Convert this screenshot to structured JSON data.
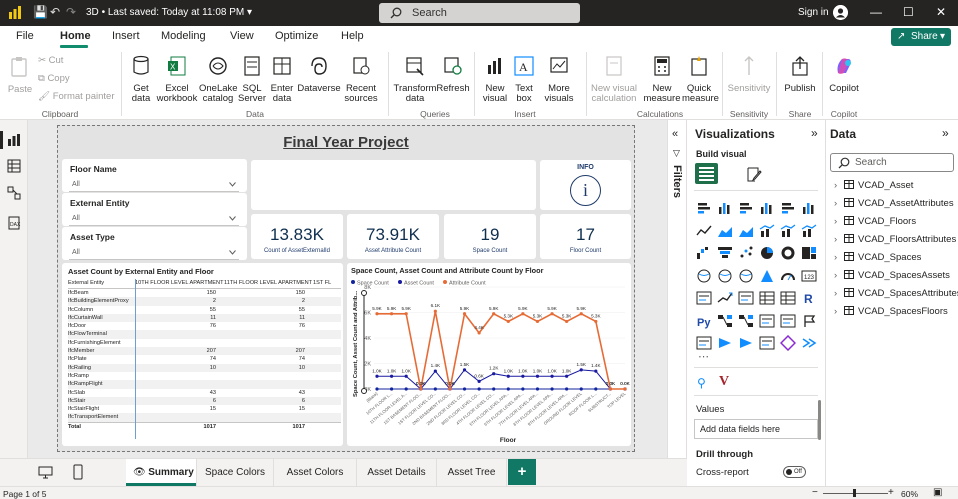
{
  "titlebar": {
    "doc_title": "3D",
    "saved_status": "Last saved: Today at 11:08 PM",
    "search_placeholder": "Search",
    "sign_in": "Sign in"
  },
  "menu": {
    "items": [
      "File",
      "Home",
      "Insert",
      "Modeling",
      "View",
      "Optimize",
      "Help"
    ],
    "active": "Home",
    "share_label": "Share"
  },
  "ribbon": {
    "clipboard": {
      "paste": "Paste",
      "cut": "Cut",
      "copy": "Copy",
      "format_painter": "Format painter",
      "group": "Clipboard"
    },
    "data": {
      "get_data": "Get data",
      "excel": "Excel workbook",
      "onelake": "OneLake catalog",
      "sql": "SQL Server",
      "enter": "Enter data",
      "dataverse": "Dataverse",
      "recent": "Recent sources",
      "group": "Data"
    },
    "queries": {
      "transform": "Transform data",
      "refresh": "Refresh",
      "group": "Queries"
    },
    "insert": {
      "new_visual": "New visual",
      "text_box": "Text box",
      "more_visuals": "More visuals",
      "group": "Insert"
    },
    "calculations": {
      "new_visual_calc": "New visual calculation",
      "new_measure": "New measure",
      "quick_measure": "Quick measure",
      "group": "Calculations"
    },
    "sensitivity": {
      "label": "Sensitivity",
      "group": "Sensitivity"
    },
    "share": {
      "publish": "Publish",
      "group": "Share"
    },
    "copilot": {
      "label": "Copilot",
      "group": "Copilot"
    }
  },
  "report": {
    "title": "Final Year Project",
    "slicers": [
      {
        "label": "Floor Name",
        "value": "All"
      },
      {
        "label": "External Entity",
        "value": "All"
      },
      {
        "label": "Asset Type",
        "value": "All"
      }
    ],
    "info_label": "INFO",
    "info_icon": "i",
    "kpis": [
      {
        "value": "13.83K",
        "label": "Count of AssetExternalId"
      },
      {
        "value": "73.91K",
        "label": "Asset Attribute Count"
      },
      {
        "value": "19",
        "label": "Space Count"
      },
      {
        "value": "17",
        "label": "Floor Count"
      }
    ],
    "table": {
      "title": "Asset Count by External Entity and Floor",
      "headers": [
        "External Entity",
        "10TH FLOOR LEVEL APARTMENT",
        "11TH FLOOR LEVEL APARTMENT",
        "1ST FL"
      ],
      "rows": [
        [
          "IfcBeam",
          "150",
          "150"
        ],
        [
          "IfcBuildingElementProxy",
          "2",
          "2"
        ],
        [
          "IfcColumn",
          "55",
          "55"
        ],
        [
          "IfcCurtainWall",
          "11",
          "11"
        ],
        [
          "IfcDoor",
          "76",
          "76"
        ],
        [
          "IfcFlowTerminal",
          "",
          ""
        ],
        [
          "IfcFurnishingElement",
          "",
          ""
        ],
        [
          "IfcMember",
          "207",
          "207"
        ],
        [
          "IfcPlate",
          "74",
          "74"
        ],
        [
          "IfcRailing",
          "10",
          "10"
        ],
        [
          "IfcRamp",
          "",
          ""
        ],
        [
          "IfcRampFlight",
          "",
          ""
        ],
        [
          "IfcSlab",
          "43",
          "43"
        ],
        [
          "IfcStair",
          "6",
          "6"
        ],
        [
          "IfcStairFlight",
          "15",
          "15"
        ],
        [
          "IfcTransportElement",
          "",
          ""
        ]
      ],
      "total": [
        "Total",
        "1017",
        "1017"
      ]
    }
  },
  "chart_data": {
    "type": "line",
    "title": "Space Count, Asset Count and Attribute Count by Floor",
    "xlabel": "Floor",
    "ylabel": "Space Count, Asset Count and Attrib...",
    "ylim": [
      0,
      8000
    ],
    "yticks": [
      "0K",
      "2K",
      "4K",
      "6K",
      "8K"
    ],
    "categories": [
      "(Blank)",
      "10TH FLOOR L...",
      "11TH FLOOR LEVEL A...",
      "1ST BASEMENT FLOO...",
      "1ST FLOOR LEVEL CO...",
      "2ND BASEMENT FLOO...",
      "2ND FLOOR LEVEL CO...",
      "3RD FLOOR LEVEL CO...",
      "4TH FLOOR LEVEL CO...",
      "5TH FLOOR LEVEL APA...",
      "6TH FLOOR LEVEL APA...",
      "7TH FLOOR LEVEL APA...",
      "8TH FLOOR LEVEL APA...",
      "9TH FLOOR LEVEL APA...",
      "GROUND FLOOR LEVEL",
      "ROOF FLOOR L...",
      "SUBSTRUCT...",
      "TOP LEVEL"
    ],
    "series": [
      {
        "name": "Space Count",
        "color": "#12239e",
        "values": [
          0,
          0,
          0,
          0,
          0,
          0,
          0,
          0,
          0,
          0,
          0,
          0,
          0,
          0,
          0,
          0,
          0,
          0
        ],
        "labels": [
          "",
          "",
          "",
          "",
          "",
          "",
          "",
          "",
          "",
          "",
          "",
          "",
          "",
          "",
          "",
          "",
          "",
          ""
        ]
      },
      {
        "name": "Asset Count",
        "color": "#1a1aa0",
        "values": [
          1000,
          1000,
          1000,
          0,
          1400,
          0,
          1500,
          600,
          1200,
          1000,
          1000,
          1000,
          1000,
          1000,
          1500,
          1400,
          0,
          0
        ],
        "labels": [
          "1.0K",
          "1.0K",
          "1.0K",
          "0.0K",
          "1.4K",
          "0.0K",
          "1.5K",
          "0.6K",
          "1.2K",
          "1.0K",
          "1.0K",
          "1.0K",
          "1.0K",
          "1.0K",
          "1.5K",
          "1.4K",
          "0.0K",
          "0.0K"
        ]
      },
      {
        "name": "Attribute Count",
        "color": "#e66c37",
        "values": [
          5900,
          5900,
          5900,
          0,
          6100,
          0,
          5900,
          4400,
          5900,
          5300,
          5900,
          5300,
          5900,
          5300,
          5900,
          5300,
          0,
          0
        ],
        "labels": [
          "5.9K",
          "5.9K",
          "5.9K",
          "0.0K",
          "6.1K",
          "0.0K",
          "5.9K",
          "4.4K",
          "5.9K",
          "5.3K",
          "5.9K",
          "5.3K",
          "5.9K",
          "5.3K",
          "5.9K",
          "5.3K",
          "0.0K",
          "0.0K"
        ]
      }
    ],
    "legend": "top-left"
  },
  "filters": {
    "label": "Filters"
  },
  "visualizations": {
    "header": "Visualizations",
    "build_visual": "Build visual",
    "values_label": "Values",
    "values_placeholder": "Add data fields here",
    "drill_through": "Drill through",
    "cross_report": "Cross-report",
    "toggle_state": "Off"
  },
  "data_pane": {
    "header": "Data",
    "search_placeholder": "Search",
    "tables": [
      "VCAD_Asset",
      "VCAD_AssetAttributes",
      "VCAD_Floors",
      "VCAD_FloorsAttributes",
      "VCAD_Spaces",
      "VCAD_SpacesAssets",
      "VCAD_SpacesAttributes",
      "VCAD_SpacesFloors"
    ]
  },
  "tabs": {
    "items": [
      "Summary",
      "Space Colors",
      "Asset Colors",
      "Asset Details",
      "Asset Tree"
    ],
    "active": "Summary",
    "add": "+"
  },
  "status": {
    "page": "Page 1 of 5",
    "zoom": "60%"
  }
}
